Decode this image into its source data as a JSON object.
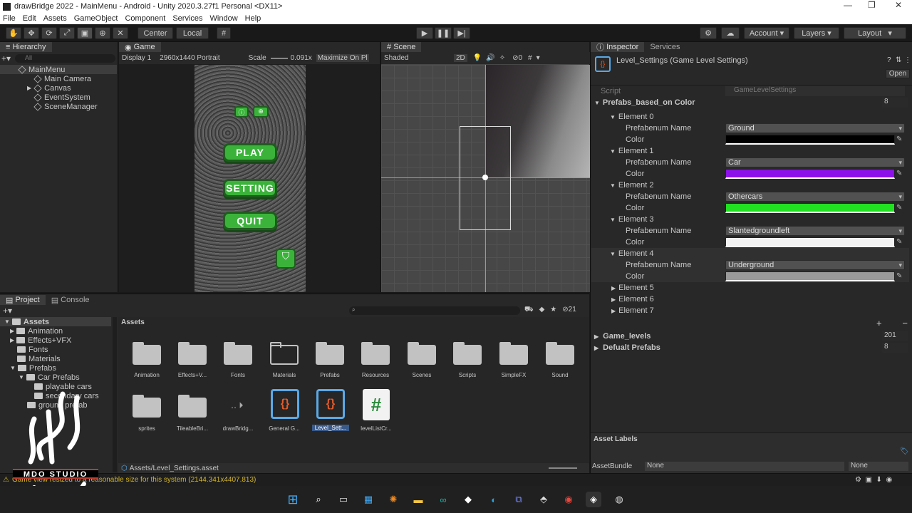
{
  "window": {
    "title": "drawBridge 2022 - MainMenu - Android - Unity 2020.3.27f1 Personal <DX11>",
    "controls": [
      "—",
      "❐",
      "✕"
    ]
  },
  "menu": [
    "File",
    "Edit",
    "Assets",
    "GameObject",
    "Component",
    "Services",
    "Window",
    "Help"
  ],
  "toolbar": {
    "pivot": "Center",
    "space": "Local",
    "account": "Account",
    "layers": "Layers",
    "layout": "Layout"
  },
  "hierarchy": {
    "tab": "Hierarchy",
    "search_placeholder": "All",
    "scene": "MainMenu",
    "items": [
      "Main Camera",
      "Canvas",
      "EventSystem",
      "SceneManager"
    ]
  },
  "game": {
    "tab": "Game",
    "display": "Display 1",
    "resolution": "2960x1440 Portrait",
    "scale_label": "Scale",
    "scale_value": "0.091x",
    "maximize": "Maximize On Pl",
    "buttons": [
      "PLAY",
      "SETTING",
      "QUIT"
    ]
  },
  "scene": {
    "tab": "Scene",
    "mode": "Shaded",
    "twod": "2D",
    "hidden_count": "0"
  },
  "inspector": {
    "tab": "Inspector",
    "tab2": "Services",
    "object_title": "Level_Settings (Game Level Settings)",
    "open_button": "Open",
    "script_label": "Script",
    "script_value": "GameLevelSettings",
    "list_label": "Prefabs_based_on Color",
    "list_count": "8",
    "prefab_label": "Prefabenum Name",
    "color_label": "Color",
    "elements": [
      {
        "name": "Element 0",
        "prefab": "Ground",
        "color": "#000000"
      },
      {
        "name": "Element 1",
        "prefab": "Car",
        "color": "#8c10e8"
      },
      {
        "name": "Element 2",
        "prefab": "Othercars",
        "color": "#22e022"
      },
      {
        "name": "Element 3",
        "prefab": "Slantedgroundleft",
        "color": "#f2f2f2"
      },
      {
        "name": "Element 4",
        "prefab": "Underground",
        "color": "#9a9a9a"
      }
    ],
    "collapsed_elements": [
      "Element 5",
      "Element 6",
      "Element 7"
    ],
    "add_remove": [
      "+",
      "−"
    ],
    "game_levels_label": "Game_levels",
    "game_levels_value": "201",
    "default_prefabs_label": "Defualt Prefabs",
    "default_prefabs_value": "8",
    "asset_labels": "Asset Labels",
    "asset_bundle_label": "AssetBundle",
    "asset_bundle_value": "None",
    "asset_variant_value": "None"
  },
  "project": {
    "tab": "Project",
    "tab2": "Console",
    "hidden_count": "21",
    "tree": [
      {
        "label": "Assets",
        "level": 0
      },
      {
        "label": "Animation",
        "level": 1
      },
      {
        "label": "Effects+VFX",
        "level": 1
      },
      {
        "label": "Fonts",
        "level": 1
      },
      {
        "label": "Materials",
        "level": 1
      },
      {
        "label": "Prefabs",
        "level": 1
      },
      {
        "label": "Car Prefabs",
        "level": 2
      },
      {
        "label": "playable cars",
        "level": 3
      },
      {
        "label": "secondary cars",
        "level": 3
      },
      {
        "label": "ground prefab",
        "level": 2
      }
    ],
    "breadcrumb": "Assets",
    "assets_row1": [
      "Animation",
      "Effects+V...",
      "Fonts",
      "Materials",
      "Prefabs",
      "Resources",
      "Scenes",
      "Scripts",
      "SimpleFX",
      "Sound"
    ],
    "assets_row2": [
      "sprites",
      "TileableBri...",
      "drawBridg...",
      "General G...",
      "Level_Sett...",
      "levelListCr..."
    ],
    "selected_path": "Assets/Level_Settings.asset"
  },
  "status": {
    "message": "Game view resized to a reasonable size for this system (2144.341x4407.813)"
  },
  "watermark": "MDO STUDIO"
}
